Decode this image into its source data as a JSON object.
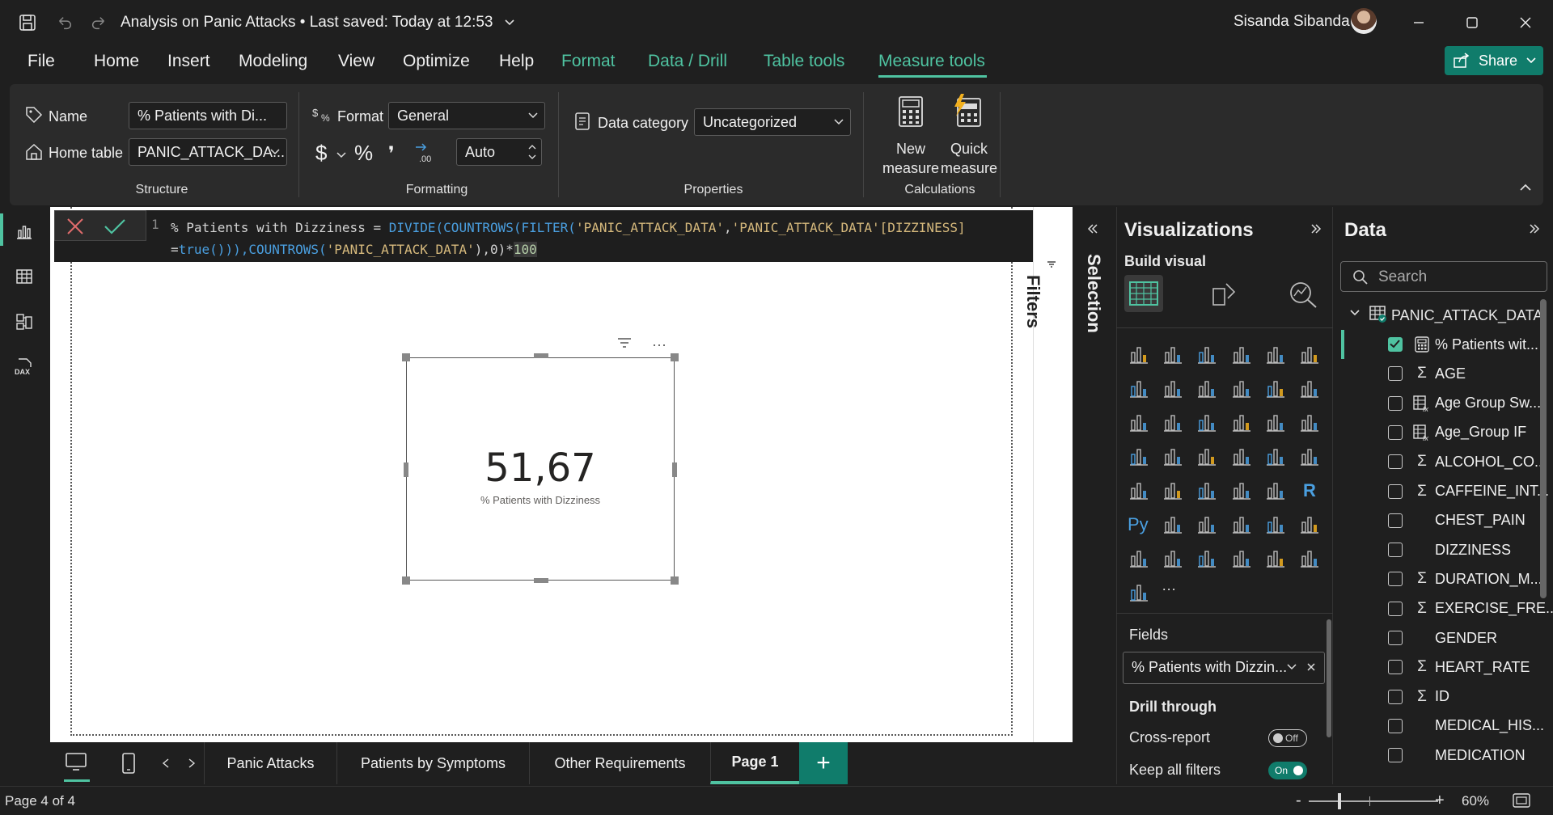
{
  "titlebar": {
    "doc_title": "Analysis on Panic Attacks",
    "saved_status": "Last saved: Today at 12:53",
    "user_name": "Sisanda Sibanda"
  },
  "menu": {
    "items": [
      "File",
      "Home",
      "Insert",
      "Modeling",
      "View",
      "Optimize",
      "Help",
      "Format",
      "Data / Drill",
      "Table tools",
      "Measure tools"
    ],
    "active": "Measure tools",
    "share_label": "Share"
  },
  "ribbon": {
    "structure": {
      "name_label": "Name",
      "name_value": "% Patients with Di...",
      "home_table_label": "Home table",
      "home_table_value": "PANIC_ATTACK_DA...",
      "group_label": "Structure"
    },
    "formatting": {
      "format_label": "Format",
      "format_value": "General",
      "currency_symbol": "$",
      "percent_symbol": "%",
      "comma_symbol": "❜",
      "decimals_value": "Auto",
      "group_label": "Formatting"
    },
    "properties": {
      "data_category_label": "Data category",
      "data_category_value": "Uncategorized",
      "group_label": "Properties"
    },
    "calculations": {
      "new_measure_line1": "New",
      "new_measure_line2": "measure",
      "quick_measure_line1": "Quick",
      "quick_measure_line2": "measure",
      "group_label": "Calculations"
    }
  },
  "formula": {
    "line_number": "1",
    "measure_name": "% Patients with Dizziness",
    "operator": " = ",
    "fn_divide": "DIVIDE(",
    "fn_countrows1": "COUNTROWS(",
    "fn_filter": "FILTER(",
    "str_table1": "'PANIC_ATTACK_DATA'",
    "comma1": ",",
    "str_column": "'PANIC_ATTACK_DATA'[DIZZINESS]",
    "line2_eq": "=",
    "fn_true": "true()",
    "close1": ")),",
    "fn_countrows2": "COUNTROWS(",
    "str_table2": "'PANIC_ATTACK_DATA'",
    "close2": "),0)*",
    "num_100": "100"
  },
  "canvas": {
    "filters_label": "Filters",
    "card_value": "51,67",
    "card_label": "% Patients with Dizziness"
  },
  "page_tabs": {
    "tabs": [
      "Panic Attacks",
      "Patients by Symptoms",
      "Other Requirements",
      "Page 1"
    ],
    "active": "Page 1",
    "add_label": "+"
  },
  "selection_label": "Selection",
  "visualizations": {
    "title": "Visualizations",
    "build_visual_label": "Build visual",
    "fields_label": "Fields",
    "field_value": "% Patients with Dizzin...",
    "drill_through_label": "Drill through",
    "cross_report_label": "Cross-report",
    "cross_report_state": "Off",
    "keep_filters_label": "Keep all filters",
    "keep_filters_state": "On",
    "more_label": "···"
  },
  "data_pane": {
    "title": "Data",
    "search_placeholder": "Search",
    "table_name": "PANIC_ATTACK_DATA",
    "fields": [
      {
        "name": "% Patients wit...",
        "type": "measure",
        "checked": true
      },
      {
        "name": "AGE",
        "type": "sum",
        "checked": false
      },
      {
        "name": "Age Group Sw...",
        "type": "calc",
        "checked": false
      },
      {
        "name": "Age_Group IF",
        "type": "calc",
        "checked": false
      },
      {
        "name": "ALCOHOL_CO...",
        "type": "sum",
        "checked": false
      },
      {
        "name": "CAFFEINE_INT...",
        "type": "sum",
        "checked": false
      },
      {
        "name": "CHEST_PAIN",
        "type": "none",
        "checked": false
      },
      {
        "name": "DIZZINESS",
        "type": "none",
        "checked": false
      },
      {
        "name": "DURATION_M...",
        "type": "sum",
        "checked": false
      },
      {
        "name": "EXERCISE_FRE...",
        "type": "sum",
        "checked": false
      },
      {
        "name": "GENDER",
        "type": "none",
        "checked": false
      },
      {
        "name": "HEART_RATE",
        "type": "sum",
        "checked": false
      },
      {
        "name": "ID",
        "type": "sum",
        "checked": false
      },
      {
        "name": "MEDICAL_HIS...",
        "type": "none",
        "checked": false
      },
      {
        "name": "MEDICATION",
        "type": "none",
        "checked": false
      }
    ]
  },
  "status": {
    "page_info": "Page 4 of 4",
    "zoom_minus": "-",
    "zoom_plus": "+",
    "zoom_level": "60%"
  },
  "colors": {
    "accent": "#4fc3a1",
    "share_bg": "#107c6b"
  }
}
